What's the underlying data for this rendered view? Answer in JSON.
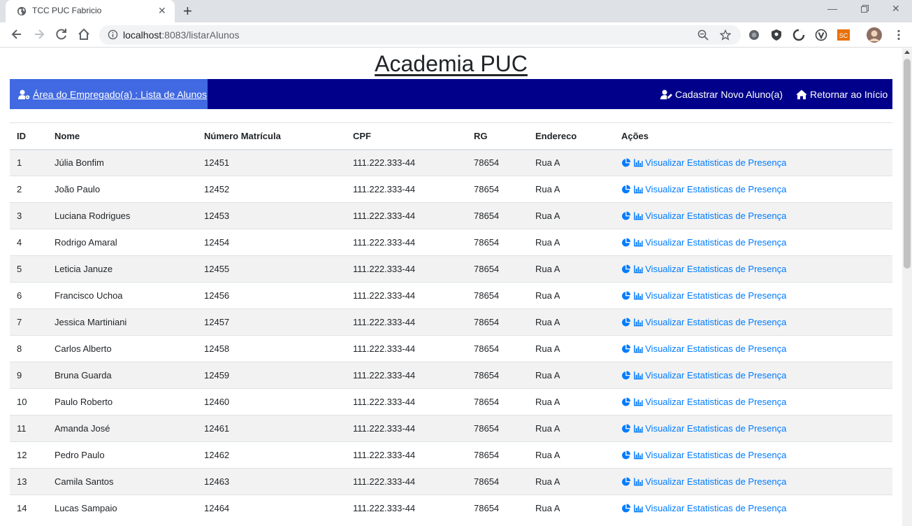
{
  "browser": {
    "tab_title": "TCC PUC Fabricio",
    "url_host": "localhost",
    "url_path": ":8083/listarAlunos",
    "extension_badge": "SC"
  },
  "page": {
    "title": "Academia PUC",
    "nav": {
      "area_label": "Área do Empregado(a) : Lista de Alunos",
      "register_label": "Cadastrar Novo Aluno(a)",
      "home_label": "Retornar ao Início"
    }
  },
  "table": {
    "headers": [
      "ID",
      "Nome",
      "Número Matrícula",
      "CPF",
      "RG",
      "Endereco",
      "Ações"
    ],
    "action_label": "Visualizar Estatisticas de Presença",
    "rows": [
      [
        "1",
        "Júlia Bonfim",
        "12451",
        "111.222.333-44",
        "78654",
        "Rua A"
      ],
      [
        "2",
        "João Paulo",
        "12452",
        "111.222.333-44",
        "78654",
        "Rua A"
      ],
      [
        "3",
        "Luciana Rodrigues",
        "12453",
        "111.222.333-44",
        "78654",
        "Rua A"
      ],
      [
        "4",
        "Rodrigo Amaral",
        "12454",
        "111.222.333-44",
        "78654",
        "Rua A"
      ],
      [
        "5",
        "Leticia Januze",
        "12455",
        "111.222.333-44",
        "78654",
        "Rua A"
      ],
      [
        "6",
        "Francisco Uchoa",
        "12456",
        "111.222.333-44",
        "78654",
        "Rua A"
      ],
      [
        "7",
        "Jessica Martiniani",
        "12457",
        "111.222.333-44",
        "78654",
        "Rua A"
      ],
      [
        "8",
        "Carlos Alberto",
        "12458",
        "111.222.333-44",
        "78654",
        "Rua A"
      ],
      [
        "9",
        "Bruna Guarda",
        "12459",
        "111.222.333-44",
        "78654",
        "Rua A"
      ],
      [
        "10",
        "Paulo Roberto",
        "12460",
        "111.222.333-44",
        "78654",
        "Rua A"
      ],
      [
        "11",
        "Amanda José",
        "12461",
        "111.222.333-44",
        "78654",
        "Rua A"
      ],
      [
        "12",
        "Pedro Paulo",
        "12462",
        "111.222.333-44",
        "78654",
        "Rua A"
      ],
      [
        "13",
        "Camila Santos",
        "12463",
        "111.222.333-44",
        "78654",
        "Rua A"
      ],
      [
        "14",
        "Lucas Sampaio",
        "12464",
        "111.222.333-44",
        "78654",
        "Rua A"
      ]
    ]
  }
}
